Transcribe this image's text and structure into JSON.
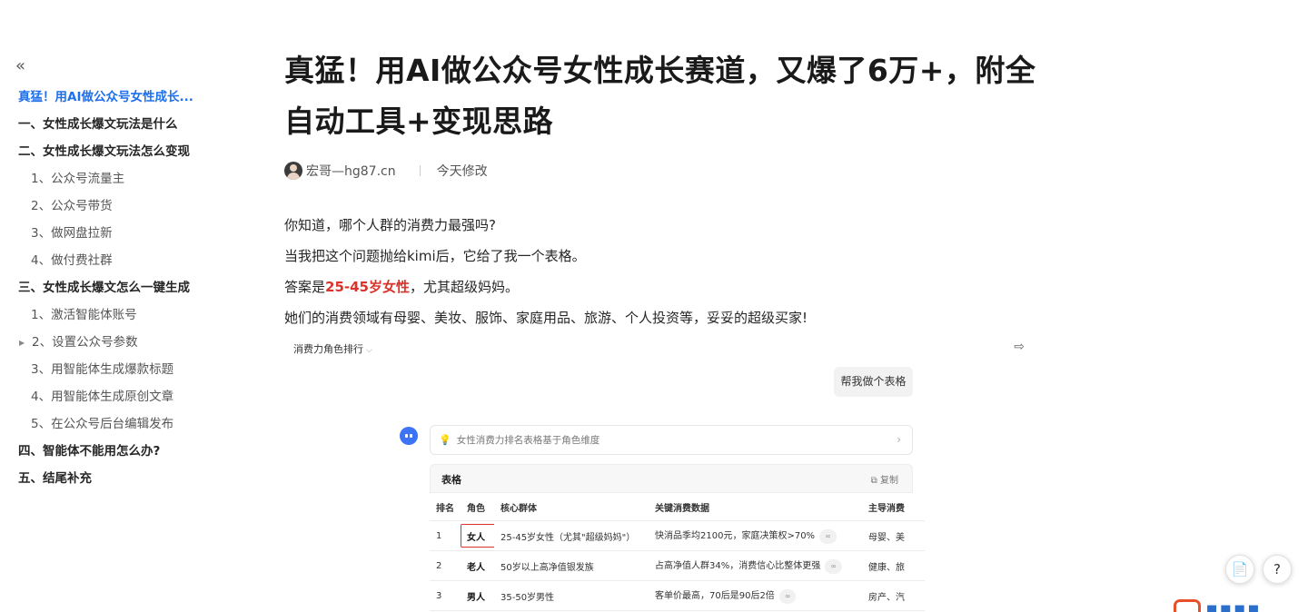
{
  "toc": {
    "collapse_glyph": "«",
    "items": [
      {
        "label": "真猛！用AI做公众号女性成长...",
        "level": 1,
        "active": true
      },
      {
        "label": "一、女性成长爆文玩法是什么",
        "level": 1
      },
      {
        "label": "二、女性成长爆文玩法怎么变现",
        "level": 1
      },
      {
        "label": "1、公众号流量主",
        "level": 2
      },
      {
        "label": "2、公众号带货",
        "level": 2
      },
      {
        "label": "3、做网盘拉新",
        "level": 2
      },
      {
        "label": "4、做付费社群",
        "level": 2
      },
      {
        "label": "三、女性成长爆文怎么一键生成",
        "level": 1
      },
      {
        "label": "1、激活智能体账号",
        "level": 2
      },
      {
        "label": "2、设置公众号参数",
        "level": 2,
        "caret": true
      },
      {
        "label": "3、用智能体生成爆款标题",
        "level": 2
      },
      {
        "label": "4、用智能体生成原创文章",
        "level": 2
      },
      {
        "label": "5、在公众号后台编辑发布",
        "level": 2
      },
      {
        "label": "四、智能体不能用怎么办?",
        "level": 1
      },
      {
        "label": "五、结尾补充",
        "level": 1
      }
    ]
  },
  "article": {
    "title": "真猛！用AI做公众号女性成长赛道，又爆了6万+，附全自动工具+变现思路",
    "author": "宏哥—hg87.cn",
    "modified": "今天修改",
    "para1": "你知道，哪个人群的消费力最强吗?",
    "para2": "当我把这个问题抛给kimi后，它给了我一个表格。",
    "para3_prefix": "答案是",
    "para3_highlight": "25-45岁女性",
    "para3_suffix": "，尤其超级妈妈。",
    "para4": "她们的消费领域有母婴、美妆、服饰、家庭用品、旅游、个人投资等，妥妥的超级买家!"
  },
  "screenshot": {
    "header": "消费力角色排行",
    "user_bubble": "帮我做个表格",
    "prompt": "女性消费力排名表格基于角色维度",
    "table_label": "表格",
    "copy_label": "复制",
    "columns": [
      "排名",
      "角色",
      "核心群体",
      "关键消费数据",
      "主导消费"
    ],
    "rows": [
      {
        "rank": "1",
        "role": "女人",
        "group": "25-45岁女性（尤其\"超级妈妈\"）",
        "data": "快消品季均2100元，家庭决策权>70%",
        "domain": "母婴、美"
      },
      {
        "rank": "2",
        "role": "老人",
        "group": "50岁以上高净值银发族",
        "data": "占高净值人群34%，消费信心比整体更强",
        "domain": "健康、旅"
      },
      {
        "rank": "3",
        "role": "男人",
        "group": "35-50岁男性",
        "data": "客单价最高，70后是90后2倍",
        "domain": "房产、汽"
      }
    ]
  },
  "floating": {
    "doc_button": "📄",
    "help_button": "?"
  },
  "colors": {
    "link_active": "#1f6feb",
    "highlight": "#d9342b",
    "bot_avatar": "#3d74f5",
    "logo_mark": "#e8502a"
  }
}
